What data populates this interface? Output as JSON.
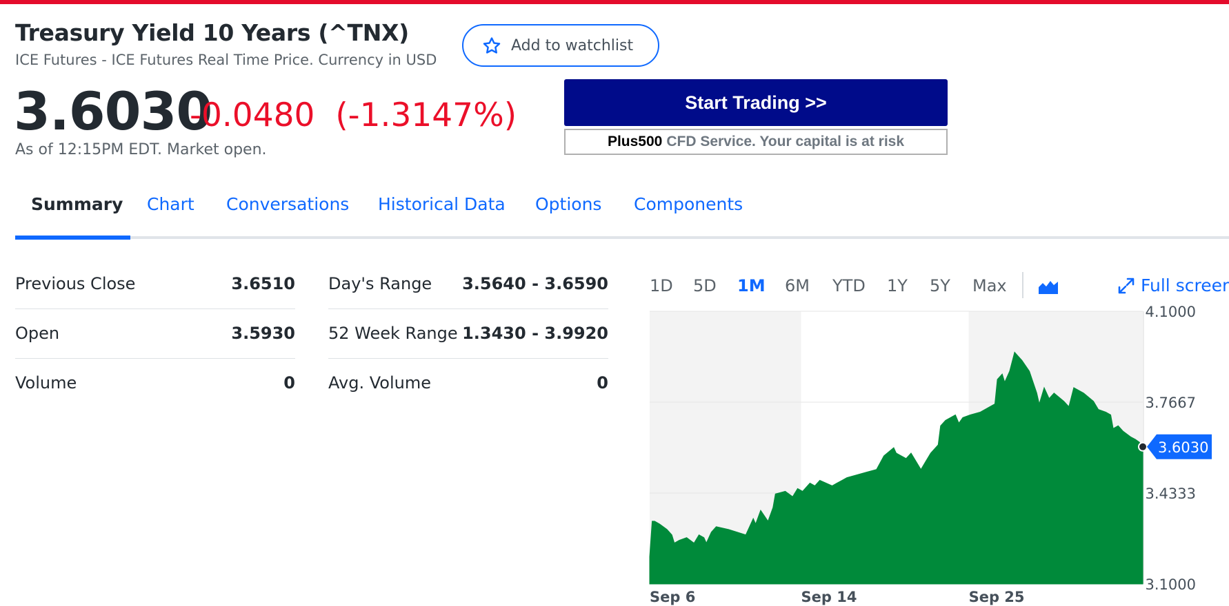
{
  "quote": {
    "title": "Treasury Yield 10 Years (^TNX)",
    "subtitle": "ICE Futures - ICE Futures Real Time Price. Currency in USD",
    "price": "3.6030",
    "change": "-0.0480",
    "change_percent": "(-1.3147%)",
    "as_of": "As of 12:15PM EDT. Market open.",
    "change_color": "#eb0f29"
  },
  "watchlist": {
    "label": "Add to watchlist",
    "icon": "star-outline-icon"
  },
  "ad": {
    "button_label": "Start Trading >>",
    "brand": "Plus500",
    "disclaimer": "CFD Service. Your capital is at risk",
    "button_color": "#000b8a"
  },
  "tabs": [
    {
      "label": "Summary",
      "active": true
    },
    {
      "label": "Chart",
      "active": false
    },
    {
      "label": "Conversations",
      "active": false
    },
    {
      "label": "Historical Data",
      "active": false
    },
    {
      "label": "Options",
      "active": false
    },
    {
      "label": "Components",
      "active": false
    }
  ],
  "stats": {
    "left": [
      {
        "label": "Previous Close",
        "value": "3.6510"
      },
      {
        "label": "Open",
        "value": "3.5930"
      },
      {
        "label": "Volume",
        "value": "0"
      }
    ],
    "right": [
      {
        "label": "Day's Range",
        "value": "3.5640 - 3.6590"
      },
      {
        "label": "52 Week Range",
        "value": "1.3430 - 3.9920"
      },
      {
        "label": "Avg. Volume",
        "value": "0"
      }
    ]
  },
  "chart_controls": {
    "ranges": [
      "1D",
      "5D",
      "1M",
      "6M",
      "YTD",
      "1Y",
      "5Y",
      "Max"
    ],
    "active_range": "1M",
    "chart_type_icon": "mountain-chart-icon",
    "fullscreen_label": "Full screen",
    "fullscreen_icon": "expand-arrows-icon"
  },
  "chart_data": {
    "type": "area",
    "title": "",
    "xlabel": "",
    "ylabel": "",
    "ylim": [
      3.1,
      4.1
    ],
    "yticks": [
      "4.1000",
      "3.7667",
      "3.4333",
      "3.1000"
    ],
    "xticks": [
      {
        "label": "Sep 6",
        "x": 0
      },
      {
        "label": "Sep 14",
        "x": 0.307
      },
      {
        "label": "Sep 25",
        "x": 0.647
      }
    ],
    "current_value_label": "3.6030",
    "fill_color": "#008a3a",
    "accent_color": "#0f69ff",
    "shaded_bands": [
      [
        0,
        0.307
      ],
      [
        0.647,
        1.0
      ]
    ],
    "series": [
      {
        "x": [
          0,
          0.005,
          0.01,
          0.02,
          0.035,
          0.045,
          0.05,
          0.06,
          0.075,
          0.09,
          0.1,
          0.11,
          0.115,
          0.125,
          0.135,
          0.16,
          0.195,
          0.21,
          0.215,
          0.225,
          0.24,
          0.25,
          0.255,
          0.275,
          0.29,
          0.3,
          0.31,
          0.325,
          0.335,
          0.345,
          0.37,
          0.38,
          0.39,
          0.4,
          0.42,
          0.44,
          0.46,
          0.475,
          0.495,
          0.5,
          0.51,
          0.52,
          0.53,
          0.54,
          0.55,
          0.56,
          0.57,
          0.585,
          0.59,
          0.6,
          0.62,
          0.627,
          0.635,
          0.65,
          0.67,
          0.69,
          0.7,
          0.705,
          0.715,
          0.72,
          0.73,
          0.74,
          0.745,
          0.755,
          0.77,
          0.785,
          0.79,
          0.8,
          0.81,
          0.82,
          0.84,
          0.85,
          0.86,
          0.87,
          0.88,
          0.9,
          0.91,
          0.925,
          0.935,
          0.94,
          0.95,
          0.96,
          0.975,
          0.985,
          0.993,
          1.0
        ],
        "y": [
          3.2,
          3.33,
          3.33,
          3.32,
          3.3,
          3.28,
          3.25,
          3.26,
          3.27,
          3.25,
          3.28,
          3.27,
          3.25,
          3.29,
          3.31,
          3.3,
          3.28,
          3.34,
          3.32,
          3.37,
          3.33,
          3.38,
          3.43,
          3.44,
          3.42,
          3.45,
          3.44,
          3.47,
          3.46,
          3.48,
          3.46,
          3.47,
          3.48,
          3.49,
          3.5,
          3.51,
          3.52,
          3.57,
          3.6,
          3.58,
          3.57,
          3.56,
          3.58,
          3.55,
          3.52,
          3.55,
          3.58,
          3.61,
          3.68,
          3.7,
          3.72,
          3.69,
          3.71,
          3.72,
          3.73,
          3.75,
          3.76,
          3.85,
          3.87,
          3.84,
          3.88,
          3.95,
          3.94,
          3.92,
          3.88,
          3.8,
          3.76,
          3.82,
          3.78,
          3.8,
          3.77,
          3.75,
          3.82,
          3.81,
          3.8,
          3.77,
          3.74,
          3.73,
          3.72,
          3.67,
          3.68,
          3.66,
          3.64,
          3.63,
          3.62,
          3.603
        ]
      }
    ]
  }
}
